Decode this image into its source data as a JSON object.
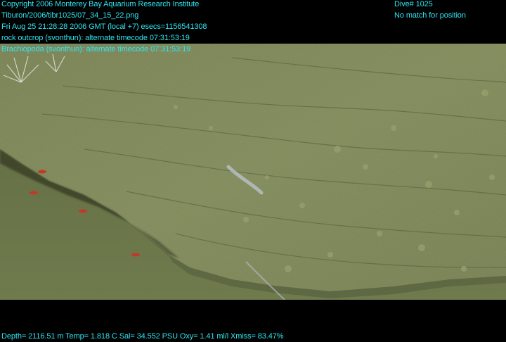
{
  "overlay": {
    "copyright": "Copyright 2006 Monterey Bay Aquarium Research Institute",
    "image_path": "Tiburon/2006/tibr1025/07_34_15_22.png",
    "timestamp": "Fri Aug 25 21:28:28 2006 GMT (local +7)  esecs=1156541308",
    "annotation_1": "rock outcrop (svonthun): alternate timecode 07:31:53:19",
    "annotation_2": "Brachiopoda (svonthun): alternate timecode 07:31:53:19",
    "dive": "Dive# 1025",
    "position": "No match for position",
    "telemetry": "Depth= 2116.51 m  Temp= 1.818 C  Sal= 34.552 PSU  Oxy= 1.41 ml/l  Xmiss= 83.47%"
  },
  "colors": {
    "overlay_text": "#2ee6f0",
    "letterbox": "#000000",
    "sediment": "#6d7a4a",
    "rock": "#7d8655"
  }
}
